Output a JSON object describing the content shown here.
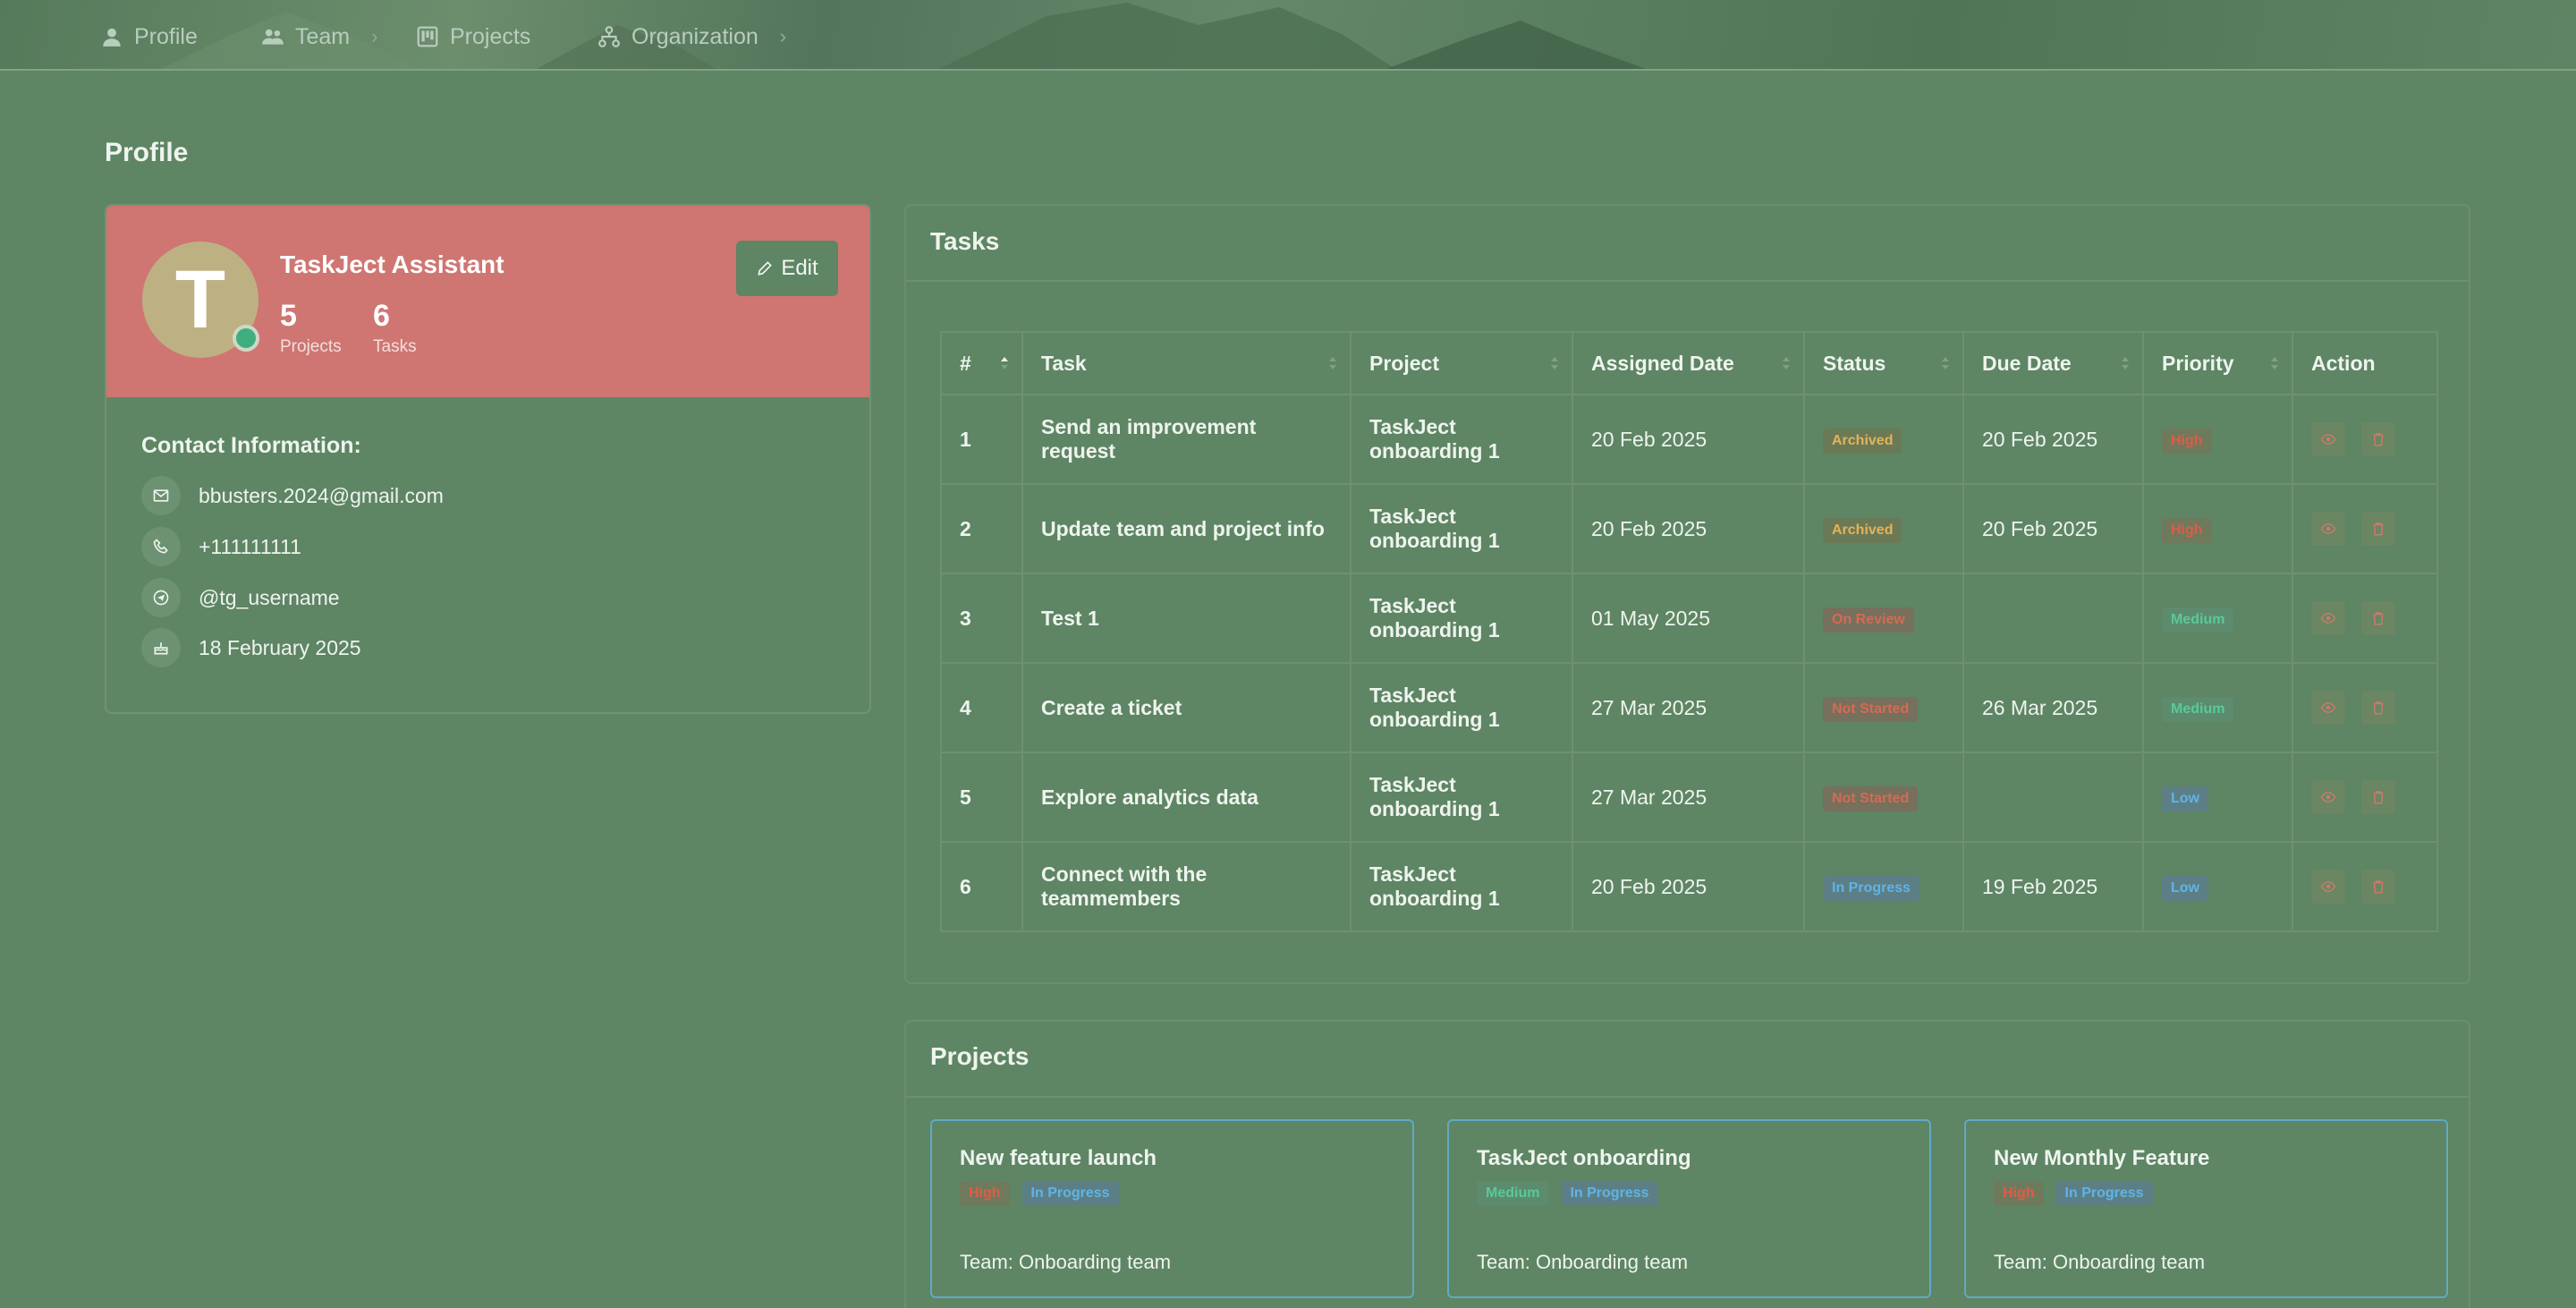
{
  "nav": {
    "items": [
      {
        "label": "Profile",
        "icon": "user-icon"
      },
      {
        "label": "Team",
        "icon": "users-icon"
      },
      {
        "label": "Projects",
        "icon": "board-icon"
      },
      {
        "label": "Organization",
        "icon": "org-chart-icon"
      }
    ]
  },
  "page": {
    "title": "Profile"
  },
  "profile": {
    "initial": "T",
    "name": "TaskJect Assistant",
    "projects_count": "5",
    "projects_label": "Projects",
    "tasks_count": "6",
    "tasks_label": "Tasks",
    "edit_label": "Edit",
    "contact_title": "Contact Information:",
    "email": "bbusters.2024@gmail.com",
    "phone": "+111111111",
    "telegram": "@tg_username",
    "joined": "18 February 2025"
  },
  "tasks": {
    "title": "Tasks",
    "columns": [
      "#",
      "Task",
      "Project",
      "Assigned Date",
      "Status",
      "Due Date",
      "Priority",
      "Action"
    ],
    "rows": [
      {
        "num": "1",
        "task": "Send an improvement request",
        "project": "TaskJect onboarding 1",
        "assigned": "20 Feb 2025",
        "status": "Archived",
        "due": "20 Feb 2025",
        "priority": "High"
      },
      {
        "num": "2",
        "task": "Update team and project info",
        "project": "TaskJect onboarding 1",
        "assigned": "20 Feb 2025",
        "status": "Archived",
        "due": "20 Feb 2025",
        "priority": "High"
      },
      {
        "num": "3",
        "task": "Test 1",
        "project": "TaskJect onboarding 1",
        "assigned": "01 May 2025",
        "status": "On Review",
        "due": "",
        "priority": "Medium"
      },
      {
        "num": "4",
        "task": "Create a ticket",
        "project": "TaskJect onboarding 1",
        "assigned": "27 Mar 2025",
        "status": "Not Started",
        "due": "26 Mar 2025",
        "priority": "Medium"
      },
      {
        "num": "5",
        "task": "Explore analytics data",
        "project": "TaskJect onboarding 1",
        "assigned": "27 Mar 2025",
        "status": "Not Started",
        "due": "",
        "priority": "Low"
      },
      {
        "num": "6",
        "task": "Connect with the teammembers",
        "project": "TaskJect onboarding 1",
        "assigned": "20 Feb 2025",
        "status": "In Progress",
        "due": "19 Feb 2025",
        "priority": "Low"
      }
    ]
  },
  "projects": {
    "title": "Projects",
    "items": [
      {
        "name": "New feature launch",
        "priority": "High",
        "status": "In Progress",
        "team": "Team: Onboarding team"
      },
      {
        "name": "TaskJect onboarding",
        "priority": "Medium",
        "status": "In Progress",
        "team": "Team: Onboarding team"
      },
      {
        "name": "New Monthly Feature",
        "priority": "High",
        "status": "In Progress",
        "team": "Team: Onboarding team"
      }
    ]
  }
}
